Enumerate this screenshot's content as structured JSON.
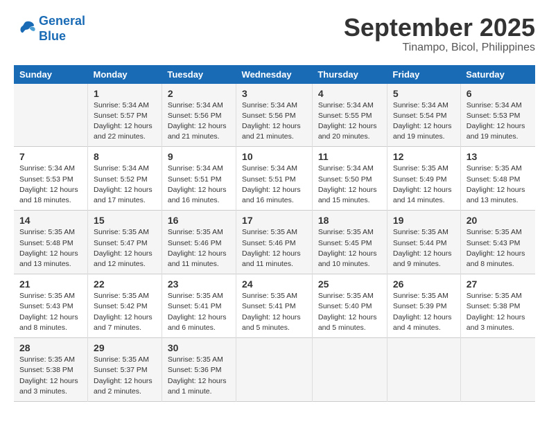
{
  "logo": {
    "line1": "General",
    "line2": "Blue"
  },
  "title": "September 2025",
  "subtitle": "Tinampo, Bicol, Philippines",
  "days_header": [
    "Sunday",
    "Monday",
    "Tuesday",
    "Wednesday",
    "Thursday",
    "Friday",
    "Saturday"
  ],
  "weeks": [
    [
      {
        "num": "",
        "info": ""
      },
      {
        "num": "1",
        "info": "Sunrise: 5:34 AM\nSunset: 5:57 PM\nDaylight: 12 hours\nand 22 minutes."
      },
      {
        "num": "2",
        "info": "Sunrise: 5:34 AM\nSunset: 5:56 PM\nDaylight: 12 hours\nand 21 minutes."
      },
      {
        "num": "3",
        "info": "Sunrise: 5:34 AM\nSunset: 5:56 PM\nDaylight: 12 hours\nand 21 minutes."
      },
      {
        "num": "4",
        "info": "Sunrise: 5:34 AM\nSunset: 5:55 PM\nDaylight: 12 hours\nand 20 minutes."
      },
      {
        "num": "5",
        "info": "Sunrise: 5:34 AM\nSunset: 5:54 PM\nDaylight: 12 hours\nand 19 minutes."
      },
      {
        "num": "6",
        "info": "Sunrise: 5:34 AM\nSunset: 5:53 PM\nDaylight: 12 hours\nand 19 minutes."
      }
    ],
    [
      {
        "num": "7",
        "info": "Sunrise: 5:34 AM\nSunset: 5:53 PM\nDaylight: 12 hours\nand 18 minutes."
      },
      {
        "num": "8",
        "info": "Sunrise: 5:34 AM\nSunset: 5:52 PM\nDaylight: 12 hours\nand 17 minutes."
      },
      {
        "num": "9",
        "info": "Sunrise: 5:34 AM\nSunset: 5:51 PM\nDaylight: 12 hours\nand 16 minutes."
      },
      {
        "num": "10",
        "info": "Sunrise: 5:34 AM\nSunset: 5:51 PM\nDaylight: 12 hours\nand 16 minutes."
      },
      {
        "num": "11",
        "info": "Sunrise: 5:34 AM\nSunset: 5:50 PM\nDaylight: 12 hours\nand 15 minutes."
      },
      {
        "num": "12",
        "info": "Sunrise: 5:35 AM\nSunset: 5:49 PM\nDaylight: 12 hours\nand 14 minutes."
      },
      {
        "num": "13",
        "info": "Sunrise: 5:35 AM\nSunset: 5:48 PM\nDaylight: 12 hours\nand 13 minutes."
      }
    ],
    [
      {
        "num": "14",
        "info": "Sunrise: 5:35 AM\nSunset: 5:48 PM\nDaylight: 12 hours\nand 13 minutes."
      },
      {
        "num": "15",
        "info": "Sunrise: 5:35 AM\nSunset: 5:47 PM\nDaylight: 12 hours\nand 12 minutes."
      },
      {
        "num": "16",
        "info": "Sunrise: 5:35 AM\nSunset: 5:46 PM\nDaylight: 12 hours\nand 11 minutes."
      },
      {
        "num": "17",
        "info": "Sunrise: 5:35 AM\nSunset: 5:46 PM\nDaylight: 12 hours\nand 11 minutes."
      },
      {
        "num": "18",
        "info": "Sunrise: 5:35 AM\nSunset: 5:45 PM\nDaylight: 12 hours\nand 10 minutes."
      },
      {
        "num": "19",
        "info": "Sunrise: 5:35 AM\nSunset: 5:44 PM\nDaylight: 12 hours\nand 9 minutes."
      },
      {
        "num": "20",
        "info": "Sunrise: 5:35 AM\nSunset: 5:43 PM\nDaylight: 12 hours\nand 8 minutes."
      }
    ],
    [
      {
        "num": "21",
        "info": "Sunrise: 5:35 AM\nSunset: 5:43 PM\nDaylight: 12 hours\nand 8 minutes."
      },
      {
        "num": "22",
        "info": "Sunrise: 5:35 AM\nSunset: 5:42 PM\nDaylight: 12 hours\nand 7 minutes."
      },
      {
        "num": "23",
        "info": "Sunrise: 5:35 AM\nSunset: 5:41 PM\nDaylight: 12 hours\nand 6 minutes."
      },
      {
        "num": "24",
        "info": "Sunrise: 5:35 AM\nSunset: 5:41 PM\nDaylight: 12 hours\nand 5 minutes."
      },
      {
        "num": "25",
        "info": "Sunrise: 5:35 AM\nSunset: 5:40 PM\nDaylight: 12 hours\nand 5 minutes."
      },
      {
        "num": "26",
        "info": "Sunrise: 5:35 AM\nSunset: 5:39 PM\nDaylight: 12 hours\nand 4 minutes."
      },
      {
        "num": "27",
        "info": "Sunrise: 5:35 AM\nSunset: 5:38 PM\nDaylight: 12 hours\nand 3 minutes."
      }
    ],
    [
      {
        "num": "28",
        "info": "Sunrise: 5:35 AM\nSunset: 5:38 PM\nDaylight: 12 hours\nand 3 minutes."
      },
      {
        "num": "29",
        "info": "Sunrise: 5:35 AM\nSunset: 5:37 PM\nDaylight: 12 hours\nand 2 minutes."
      },
      {
        "num": "30",
        "info": "Sunrise: 5:35 AM\nSunset: 5:36 PM\nDaylight: 12 hours\nand 1 minute."
      },
      {
        "num": "",
        "info": ""
      },
      {
        "num": "",
        "info": ""
      },
      {
        "num": "",
        "info": ""
      },
      {
        "num": "",
        "info": ""
      }
    ]
  ]
}
